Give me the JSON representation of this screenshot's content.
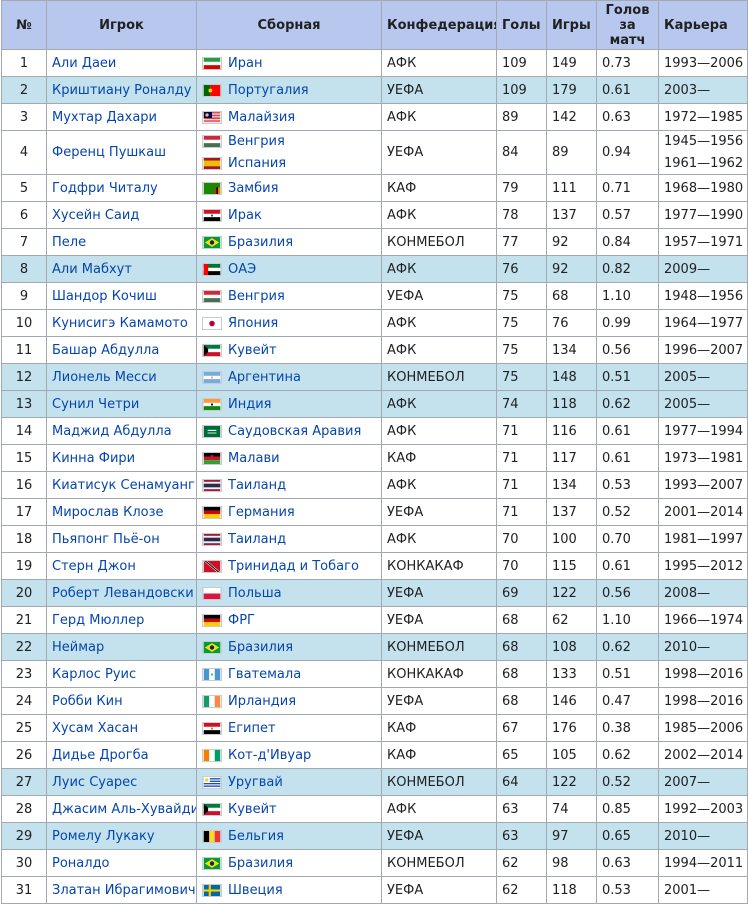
{
  "headers": {
    "num": "№",
    "player": "Игрок",
    "team": "Сборная",
    "conf": "Конфедерация",
    "goals": "Голы",
    "caps": "Игры",
    "ratio_line1": "Голов",
    "ratio_line2": "за матч",
    "career": "Карьера"
  },
  "flags": {
    "iran": [
      "#239f40",
      "#ffffff",
      "#da0000"
    ],
    "portugal": [
      "#006600",
      "#ff0000"
    ],
    "malaysia": [
      "#cc0001",
      "#ffffff",
      "#010066",
      "#ffcc00"
    ],
    "hungary": [
      "#ce2939",
      "#ffffff",
      "#477050"
    ],
    "spain": [
      "#aa151b",
      "#f1bf00",
      "#aa151b"
    ],
    "zambia": [
      "#198a00",
      "#de2010",
      "#000000",
      "#ef7d00"
    ],
    "iraq": [
      "#ce1126",
      "#ffffff",
      "#000000",
      "#007a3d"
    ],
    "brazil": [
      "#009c3b",
      "#ffdf00",
      "#002776"
    ],
    "uae": [
      "#ff0000",
      "#00732f",
      "#ffffff",
      "#000000"
    ],
    "japan": [
      "#ffffff",
      "#bc002d"
    ],
    "kuwait": [
      "#007a3d",
      "#ffffff",
      "#ce1126",
      "#000000"
    ],
    "argentina": [
      "#74acdf",
      "#ffffff",
      "#f6b40e"
    ],
    "india": [
      "#ff9933",
      "#ffffff",
      "#138808",
      "#000080"
    ],
    "saudi": [
      "#006c35",
      "#ffffff"
    ],
    "malawi": [
      "#000000",
      "#ce1126",
      "#339e35"
    ],
    "thailand": [
      "#a51931",
      "#f4f5f8",
      "#2d2a4a"
    ],
    "germany": [
      "#000000",
      "#dd0000",
      "#ffce00"
    ],
    "trinidad": [
      "#ce1126",
      "#ffffff",
      "#000000"
    ],
    "poland": [
      "#ffffff",
      "#dc143c"
    ],
    "guatemala": [
      "#4997d0",
      "#ffffff"
    ],
    "ireland": [
      "#169b62",
      "#ffffff",
      "#ff883e"
    ],
    "egypt": [
      "#ce1126",
      "#ffffff",
      "#000000",
      "#c09300"
    ],
    "ivory": [
      "#f77f00",
      "#ffffff",
      "#009e60"
    ],
    "uruguay": [
      "#ffffff",
      "#0038a8",
      "#fcd116"
    ],
    "belgium": [
      "#000000",
      "#fdda24",
      "#ef3340"
    ],
    "sweden": [
      "#006aa7",
      "#fecc00"
    ]
  },
  "rows": [
    {
      "num": "1",
      "player": "Али Даеи",
      "teams": [
        {
          "name": "Иран",
          "flag": "iran"
        }
      ],
      "conf": "АФК",
      "goals": "109",
      "caps": "149",
      "ratio": "0.73",
      "career": [
        "1993—2006"
      ],
      "current": false
    },
    {
      "num": "2",
      "player": "Криштиану Роналду",
      "teams": [
        {
          "name": "Португалия",
          "flag": "portugal"
        }
      ],
      "conf": "УЕФА",
      "goals": "109",
      "caps": "179",
      "ratio": "0.61",
      "career": [
        "2003—"
      ],
      "current": true
    },
    {
      "num": "3",
      "player": "Мухтар Дахари",
      "teams": [
        {
          "name": "Малайзия",
          "flag": "malaysia"
        }
      ],
      "conf": "АФК",
      "goals": "89",
      "caps": "142",
      "ratio": "0.63",
      "career": [
        "1972—1985"
      ],
      "current": false
    },
    {
      "num": "4",
      "player": "Ференц Пушкаш",
      "teams": [
        {
          "name": "Венгрия",
          "flag": "hungary"
        },
        {
          "name": "Испания",
          "flag": "spain"
        }
      ],
      "conf": "УЕФА",
      "goals": "84",
      "caps": "89",
      "ratio": "0.94",
      "career": [
        "1945—1956",
        "1961—1962"
      ],
      "current": false
    },
    {
      "num": "5",
      "player": "Годфри Читалу",
      "teams": [
        {
          "name": "Замбия",
          "flag": "zambia"
        }
      ],
      "conf": "КАФ",
      "goals": "79",
      "caps": "111",
      "ratio": "0.71",
      "career": [
        "1968—1980"
      ],
      "current": false
    },
    {
      "num": "6",
      "player": "Хусейн Саид",
      "teams": [
        {
          "name": "Ирак",
          "flag": "iraq"
        }
      ],
      "conf": "АФК",
      "goals": "78",
      "caps": "137",
      "ratio": "0.57",
      "career": [
        "1977—1990"
      ],
      "current": false
    },
    {
      "num": "7",
      "player": "Пеле",
      "teams": [
        {
          "name": "Бразилия",
          "flag": "brazil"
        }
      ],
      "conf": "КОНМЕБОЛ",
      "goals": "77",
      "caps": "92",
      "ratio": "0.84",
      "career": [
        "1957—1971"
      ],
      "current": false
    },
    {
      "num": "8",
      "player": "Али Мабхут",
      "teams": [
        {
          "name": "ОАЭ",
          "flag": "uae"
        }
      ],
      "conf": "АФК",
      "goals": "76",
      "caps": "92",
      "ratio": "0.82",
      "career": [
        "2009—"
      ],
      "current": true
    },
    {
      "num": "9",
      "player": "Шандор Кочиш",
      "teams": [
        {
          "name": "Венгрия",
          "flag": "hungary"
        }
      ],
      "conf": "УЕФА",
      "goals": "75",
      "caps": "68",
      "ratio": "1.10",
      "career": [
        "1948—1956"
      ],
      "current": false
    },
    {
      "num": "10",
      "player": "Кунисигэ Камамото",
      "teams": [
        {
          "name": "Япония",
          "flag": "japan"
        }
      ],
      "conf": "АФК",
      "goals": "75",
      "caps": "76",
      "ratio": "0.99",
      "career": [
        "1964—1977"
      ],
      "current": false
    },
    {
      "num": "11",
      "player": "Башар Абдулла",
      "teams": [
        {
          "name": "Кувейт",
          "flag": "kuwait"
        }
      ],
      "conf": "АФК",
      "goals": "75",
      "caps": "134",
      "ratio": "0.56",
      "career": [
        "1996—2007"
      ],
      "current": false
    },
    {
      "num": "12",
      "player": "Лионель Месси",
      "teams": [
        {
          "name": "Аргентина",
          "flag": "argentina"
        }
      ],
      "conf": "КОНМЕБОЛ",
      "goals": "75",
      "caps": "148",
      "ratio": "0.51",
      "career": [
        "2005—"
      ],
      "current": true
    },
    {
      "num": "13",
      "player": "Сунил Четри",
      "teams": [
        {
          "name": "Индия",
          "flag": "india"
        }
      ],
      "conf": "АФК",
      "goals": "74",
      "caps": "118",
      "ratio": "0.62",
      "career": [
        "2005—"
      ],
      "current": true
    },
    {
      "num": "14",
      "player": "Маджид Абдулла",
      "teams": [
        {
          "name": "Саудовская Аравия",
          "flag": "saudi"
        }
      ],
      "conf": "АФК",
      "goals": "71",
      "caps": "116",
      "ratio": "0.61",
      "career": [
        "1977—1994"
      ],
      "current": false
    },
    {
      "num": "15",
      "player": "Кинна Фири",
      "teams": [
        {
          "name": "Малави",
          "flag": "malawi"
        }
      ],
      "conf": "КАФ",
      "goals": "71",
      "caps": "117",
      "ratio": "0.61",
      "career": [
        "1973—1981"
      ],
      "current": false
    },
    {
      "num": "16",
      "player": "Киатисук Сенамуанг",
      "teams": [
        {
          "name": "Таиланд",
          "flag": "thailand"
        }
      ],
      "conf": "АФК",
      "goals": "71",
      "caps": "134",
      "ratio": "0.53",
      "career": [
        "1993—2007"
      ],
      "current": false
    },
    {
      "num": "17",
      "player": "Мирослав Клозе",
      "teams": [
        {
          "name": "Германия",
          "flag": "germany"
        }
      ],
      "conf": "УЕФА",
      "goals": "71",
      "caps": "137",
      "ratio": "0.52",
      "career": [
        "2001—2014"
      ],
      "current": false
    },
    {
      "num": "18",
      "player": "Пьяпонг Пьё-он",
      "teams": [
        {
          "name": "Таиланд",
          "flag": "thailand"
        }
      ],
      "conf": "АФК",
      "goals": "70",
      "caps": "100",
      "ratio": "0.70",
      "career": [
        "1981—1997"
      ],
      "current": false
    },
    {
      "num": "19",
      "player": "Стерн Джон",
      "teams": [
        {
          "name": "Тринидад и Тобаго",
          "flag": "trinidad"
        }
      ],
      "conf": "КОНКАКАФ",
      "goals": "70",
      "caps": "115",
      "ratio": "0.61",
      "career": [
        "1995—2012"
      ],
      "current": false
    },
    {
      "num": "20",
      "player": "Роберт Левандовски",
      "teams": [
        {
          "name": "Польша",
          "flag": "poland"
        }
      ],
      "conf": "УЕФА",
      "goals": "69",
      "caps": "122",
      "ratio": "0.56",
      "career": [
        "2008—"
      ],
      "current": true
    },
    {
      "num": "21",
      "player": "Герд Мюллер",
      "teams": [
        {
          "name": "ФРГ",
          "flag": "germany"
        }
      ],
      "conf": "УЕФА",
      "goals": "68",
      "caps": "62",
      "ratio": "1.10",
      "career": [
        "1966—1974"
      ],
      "current": false
    },
    {
      "num": "22",
      "player": "Неймар",
      "teams": [
        {
          "name": "Бразилия",
          "flag": "brazil"
        }
      ],
      "conf": "КОНМЕБОЛ",
      "goals": "68",
      "caps": "108",
      "ratio": "0.62",
      "career": [
        "2010—"
      ],
      "current": true
    },
    {
      "num": "23",
      "player": "Карлос Руис",
      "teams": [
        {
          "name": "Гватемала",
          "flag": "guatemala"
        }
      ],
      "conf": "КОНКАКАФ",
      "goals": "68",
      "caps": "133",
      "ratio": "0.51",
      "career": [
        "1998—2016"
      ],
      "current": false
    },
    {
      "num": "24",
      "player": "Робби Кин",
      "teams": [
        {
          "name": "Ирландия",
          "flag": "ireland"
        }
      ],
      "conf": "УЕФА",
      "goals": "68",
      "caps": "146",
      "ratio": "0.47",
      "career": [
        "1998—2016"
      ],
      "current": false
    },
    {
      "num": "25",
      "player": "Хусам Хасан",
      "teams": [
        {
          "name": "Египет",
          "flag": "egypt"
        }
      ],
      "conf": "КАФ",
      "goals": "67",
      "caps": "176",
      "ratio": "0.38",
      "career": [
        "1985—2006"
      ],
      "current": false
    },
    {
      "num": "26",
      "player": "Дидье Дрогба",
      "teams": [
        {
          "name": "Кот-д'Ивуар",
          "flag": "ivory"
        }
      ],
      "conf": "КАФ",
      "goals": "65",
      "caps": "105",
      "ratio": "0.62",
      "career": [
        "2002—2014"
      ],
      "current": false
    },
    {
      "num": "27",
      "player": "Луис Суарес",
      "teams": [
        {
          "name": "Уругвай",
          "flag": "uruguay"
        }
      ],
      "conf": "КОНМЕБОЛ",
      "goals": "64",
      "caps": "122",
      "ratio": "0.52",
      "career": [
        "2007—"
      ],
      "current": true
    },
    {
      "num": "28",
      "player": "Джасим Аль-Хувайди",
      "teams": [
        {
          "name": "Кувейт",
          "flag": "kuwait"
        }
      ],
      "conf": "АФК",
      "goals": "63",
      "caps": "74",
      "ratio": "0.85",
      "career": [
        "1992—2003"
      ],
      "current": false
    },
    {
      "num": "29",
      "player": "Ромелу Лукаку",
      "teams": [
        {
          "name": "Бельгия",
          "flag": "belgium"
        }
      ],
      "conf": "УЕФА",
      "goals": "63",
      "caps": "97",
      "ratio": "0.65",
      "career": [
        "2010—"
      ],
      "current": true
    },
    {
      "num": "30",
      "player": "Роналдо",
      "teams": [
        {
          "name": "Бразилия",
          "flag": "brazil"
        }
      ],
      "conf": "КОНМЕБОЛ",
      "goals": "62",
      "caps": "98",
      "ratio": "0.63",
      "career": [
        "1994—2011"
      ],
      "current": false
    },
    {
      "num": "31",
      "player": "Златан Ибрагимович",
      "teams": [
        {
          "name": "Швеция",
          "flag": "sweden"
        }
      ],
      "conf": "УЕФА",
      "goals": "62",
      "caps": "118",
      "ratio": "0.53",
      "career": [
        "2001—"
      ],
      "current": false
    }
  ]
}
